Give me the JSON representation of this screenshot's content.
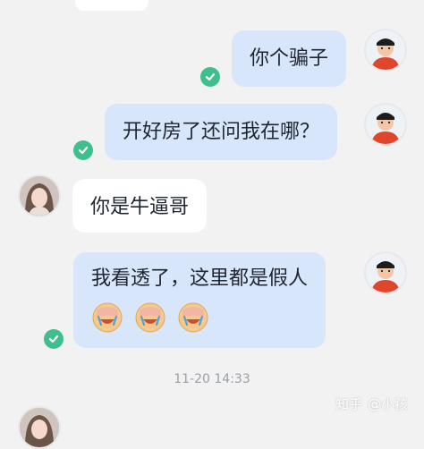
{
  "chat": {
    "messages": [
      {
        "sender": "self",
        "text": "你个骗子"
      },
      {
        "sender": "self",
        "text": "开好房了还问我在哪？"
      },
      {
        "sender": "other",
        "text": "你是牛逼哥"
      },
      {
        "sender": "self",
        "text": "我看透了，这里都是假人",
        "emoji_icons": [
          "facepalm-cry-emoji",
          "facepalm-cry-emoji",
          "facepalm-cry-emoji"
        ]
      }
    ],
    "timestamp": "11-20 14:33"
  },
  "watermark": {
    "site": "知乎",
    "user": "@小孩"
  },
  "colors": {
    "self_bubble": "#d8e6fb",
    "other_bubble": "#ffffff",
    "check": "#3fbf8c",
    "background": "#f2f2f2"
  }
}
